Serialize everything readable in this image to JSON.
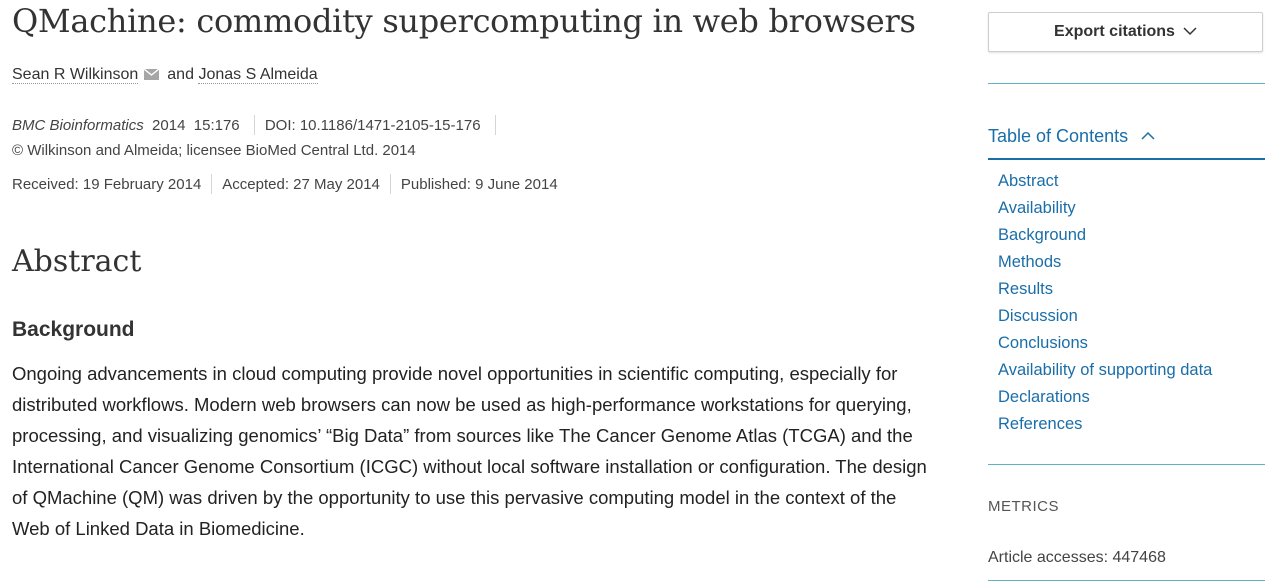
{
  "article": {
    "title": "QMachine: commodity supercomputing in web browsers",
    "authors": [
      {
        "name": "Sean R Wilkinson"
      },
      {
        "name": "Jonas S Almeida"
      }
    ],
    "author_separator": "and",
    "journal": "BMC Bioinformatics",
    "year": "2014",
    "volume_article": "15:176",
    "doi": "DOI: 10.1186/1471-2105-15-176",
    "copyright": "©  Wilkinson and Almeida; licensee BioMed Central Ltd. 2014",
    "received": "Received: 19 February 2014",
    "accepted": "Accepted: 27 May 2014",
    "published": "Published: 9 June 2014"
  },
  "abstract": {
    "heading": "Abstract",
    "section_heading": "Background",
    "text": "Ongoing advancements in cloud computing provide novel opportunities in scientific computing, especially for distributed workflows. Modern web browsers can now be used as high-performance workstations for querying, processing, and visualizing genomics’ “Big Data” from sources like The Cancer Genome Atlas (TCGA) and the International Cancer Genome Consortium (ICGC) without local software installation or configuration. The design of QMachine (QM) was driven by the opportunity to use this pervasive computing model in the context of the Web of Linked Data in Biomedicine."
  },
  "sidebar": {
    "export_label": "Export citations",
    "toc_title": "Table of Contents",
    "toc_items": [
      "Abstract",
      "Availability",
      "Background",
      "Methods",
      "Results",
      "Discussion",
      "Conclusions",
      "Availability of supporting data",
      "Declarations",
      "References"
    ],
    "metrics_title": "METRICS",
    "article_accesses": "Article accesses: 447468"
  },
  "colors": {
    "link": "#1a6ea8",
    "divider": "#5db3c4",
    "text": "#333333"
  },
  "icons": [
    "mail-icon",
    "chevron-down-icon",
    "chevron-up-icon"
  ]
}
